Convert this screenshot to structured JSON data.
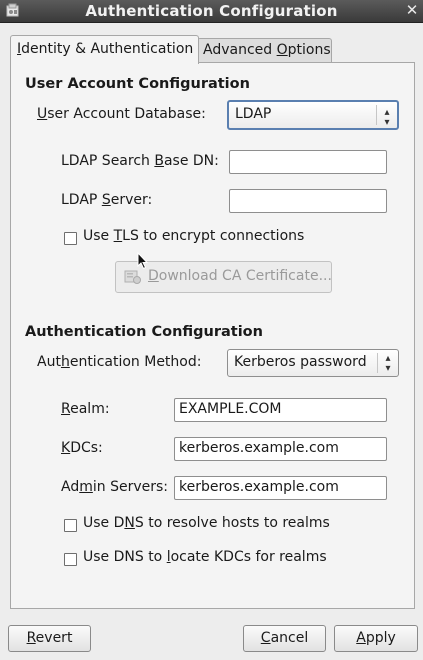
{
  "window": {
    "title": "Authentication Configuration",
    "close_glyph": "✕"
  },
  "tabs": [
    {
      "label_pre": "",
      "mnemonic": "I",
      "label_post": "dentity & Authentication",
      "active": true
    },
    {
      "label_pre": "Advanced ",
      "mnemonic": "O",
      "label_post": "ptions",
      "active": false
    }
  ],
  "user_account": {
    "section_title": "User Account Configuration",
    "database_label": {
      "pre": "",
      "mn": "U",
      "post": "ser Account Database:"
    },
    "database_value": "LDAP",
    "search_base_label": {
      "pre": "LDAP Search ",
      "mn": "B",
      "post": "ase DN:"
    },
    "search_base_value": "",
    "server_label": {
      "pre": "LDAP ",
      "mn": "S",
      "post": "erver:"
    },
    "server_value": "",
    "tls_label": {
      "pre": "Use ",
      "mn": "T",
      "post": "LS to encrypt connections"
    },
    "tls_checked": false,
    "download_button": {
      "pre": "",
      "mn": "D",
      "post": "ownload CA Certificate..."
    }
  },
  "authentication": {
    "section_title": "Authentication Configuration",
    "method_label": {
      "pre": "Aut",
      "mn": "h",
      "post": "entication Method:"
    },
    "method_value": "Kerberos password",
    "realm_label": {
      "pre": "",
      "mn": "R",
      "post": "ealm:"
    },
    "realm_value": "EXAMPLE.COM",
    "kdcs_label": {
      "pre": "",
      "mn": "K",
      "post": "DCs:"
    },
    "kdcs_value": "kerberos.example.com",
    "admin_label": {
      "pre": "Ad",
      "mn": "m",
      "post": "in Servers:"
    },
    "admin_value": "kerberos.example.com",
    "dns_realms_label": {
      "pre": "Use D",
      "mn": "N",
      "post": "S to resolve hosts to realms"
    },
    "dns_realms_checked": false,
    "dns_kdcs_label": {
      "pre": "Use DNS to ",
      "mn": "l",
      "post": "ocate KDCs for realms"
    },
    "dns_kdcs_checked": false
  },
  "buttons": {
    "revert": {
      "pre": "",
      "mn": "R",
      "post": "evert"
    },
    "cancel": {
      "pre": "",
      "mn": "C",
      "post": "ancel"
    },
    "apply": {
      "pre": "",
      "mn": "A",
      "post": "pply"
    }
  },
  "icons": {
    "window": "window-app-icon",
    "close": "close-icon",
    "combo": "spinner-arrows-icon",
    "certificate": "certificate-icon",
    "pointer": "mouse-pointer-icon"
  },
  "colors": {
    "titlebar": "#4a4a4a",
    "focus_border": "#5a7fb0",
    "panel": "#f4f4f4",
    "disabled_text": "#9a9a9a"
  }
}
